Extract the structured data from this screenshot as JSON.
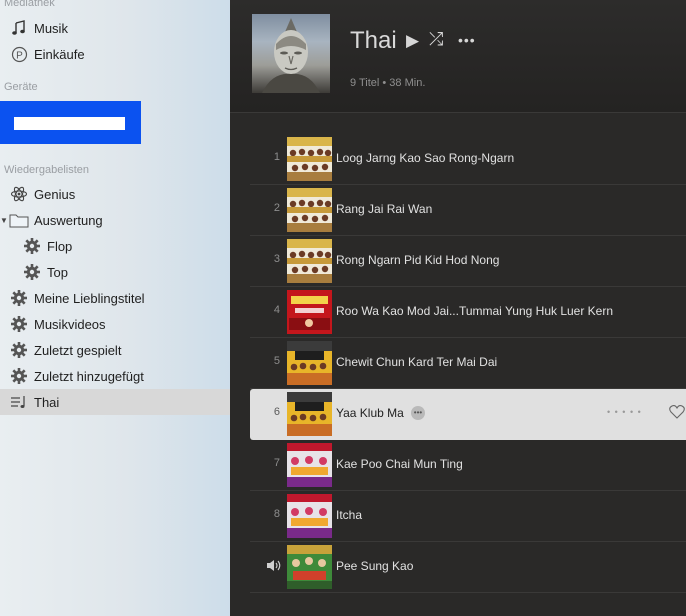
{
  "sidebar": {
    "sections": {
      "library": "Mediathek",
      "devices": "Geräte",
      "playlists": "Wiedergabelisten"
    },
    "library_items": [
      {
        "label": "Musik",
        "icon": "music-note-icon"
      },
      {
        "label": "Einkäufe",
        "icon": "purchases-icon"
      }
    ],
    "playlist_items": [
      {
        "label": "Genius",
        "icon": "genius-atom-icon"
      },
      {
        "label": "Auswertung",
        "icon": "folder-icon"
      },
      {
        "label": "Flop",
        "icon": "gear-icon"
      },
      {
        "label": "Top",
        "icon": "gear-icon"
      },
      {
        "label": "Meine Lieblingstitel",
        "icon": "gear-icon"
      },
      {
        "label": "Musikvideos",
        "icon": "gear-icon"
      },
      {
        "label": "Zuletzt gespielt",
        "icon": "gear-icon"
      },
      {
        "label": "Zuletzt hinzugefügt",
        "icon": "gear-icon"
      },
      {
        "label": "Thai",
        "icon": "playlist-icon"
      }
    ],
    "selected": "Thai",
    "highlight_color": "#0b52f0"
  },
  "playlist": {
    "title": "Thai",
    "meta": "9 Titel • 38 Min.",
    "controls": {
      "play": "▶",
      "shuffle": "⤮",
      "more": "•••"
    }
  },
  "tracks": [
    {
      "num": "1",
      "title": "Loog Jarng Kao Sao Rong-Ngarn",
      "art": "art-a"
    },
    {
      "num": "2",
      "title": "Rang Jai Rai Wan",
      "art": "art-a"
    },
    {
      "num": "3",
      "title": "Rong Ngarn Pid Kid Hod Nong",
      "art": "art-a"
    },
    {
      "num": "4",
      "title": "Roo Wa Kao Mod Jai...Tummai Yung Huk Luer Kern",
      "art": "art-b"
    },
    {
      "num": "5",
      "title": "Chewit Chun Kard Ter Mai Dai",
      "art": "art-c"
    },
    {
      "num": "6",
      "title": "Yaa Klub Ma",
      "art": "art-c",
      "selected": true,
      "rating_dots": "• • • • •"
    },
    {
      "num": "7",
      "title": "Kae Poo Chai Mun Ting",
      "art": "art-d"
    },
    {
      "num": "8",
      "title": "Itcha",
      "art": "art-d"
    },
    {
      "num": "",
      "title": "Pee Sung Kao",
      "art": "art-e",
      "playing": true
    }
  ],
  "colors": {
    "main_bg": "#2a2928",
    "sidebar_bg": "#e6ebee",
    "selected_row": "#e0e0e0",
    "text_light": "#e1e1e1"
  }
}
